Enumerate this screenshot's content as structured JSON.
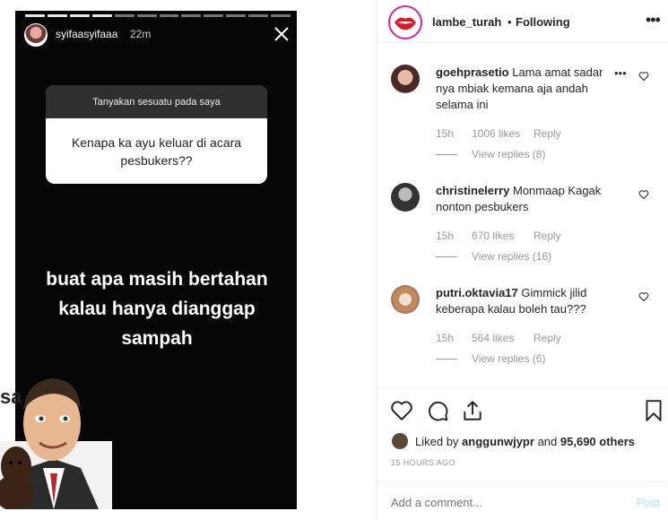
{
  "story": {
    "username": "syifaasyifaaa",
    "time": "22m",
    "question_header": "Tanyakan sesuatu pada saya",
    "question_text": "Kenapa ka ayu keluar di acara pesbukers??",
    "caption": "buat apa masih bertahan kalau hanya dianggap sampah",
    "sticker_text": "sa",
    "progress_segments": 12,
    "progress_done": 4
  },
  "post": {
    "username": "lambe_turah",
    "separator": "•",
    "follow_status": "Following",
    "more_icon": "more-horizontal-icon"
  },
  "comments": [
    {
      "username": "goehprasetio",
      "text": "Lama amat sadar nya mbiak kemana aja andah selama ini",
      "time": "15h",
      "likes": "1006 likes",
      "reply": "Reply",
      "view_replies": "View replies (8)"
    },
    {
      "username": "christinelerry",
      "text": "Monmaap Kagak nonton pesbukers",
      "time": "15h",
      "likes": "670 likes",
      "reply": "Reply",
      "view_replies": "View replies (16)"
    },
    {
      "username": "putri.oktavia17",
      "text": "Gimmick jilid keberapa kalau boleh tau???",
      "time": "15h",
      "likes": "564 likes",
      "reply": "Reply",
      "view_replies": "View replies (6)"
    }
  ],
  "likes": {
    "prefix": "Liked by",
    "user": "anggunwjypr",
    "mid": "and",
    "count": "95,690 others"
  },
  "timestamp": "15 HOURS AGO",
  "add_comment": {
    "placeholder": "Add a comment...",
    "post_label": "Post"
  },
  "colors": {
    "post_disabled": "#b2dffc",
    "muted": "#999999",
    "ring": "#d6249f"
  }
}
